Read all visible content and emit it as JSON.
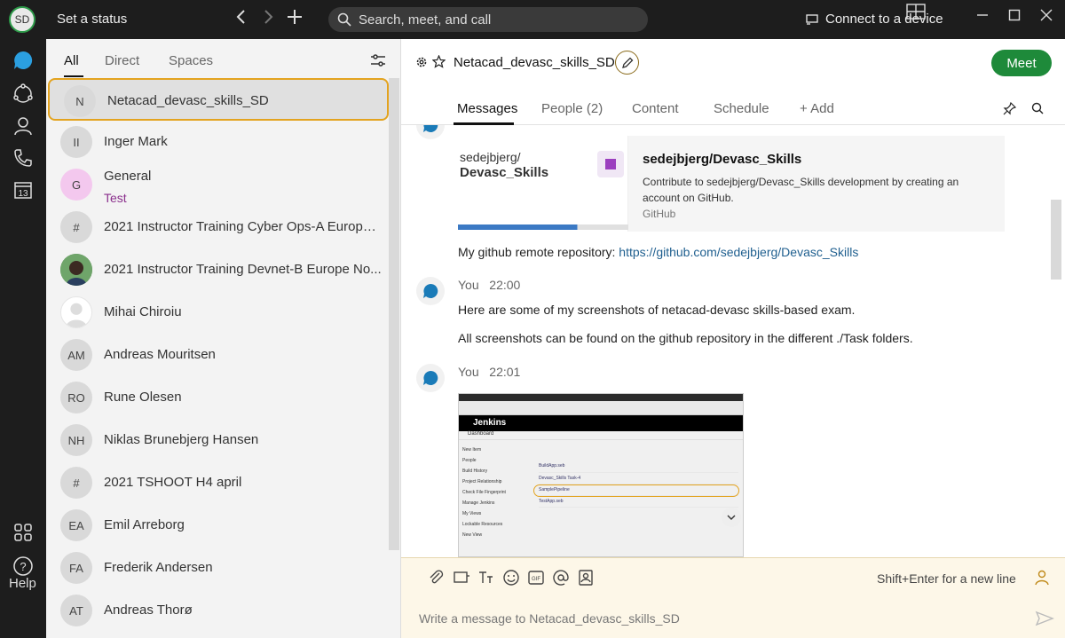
{
  "titlebar": {
    "avatar_initials": "SD",
    "set_status": "Set a status",
    "search_placeholder": "Search, meet, and call",
    "connect": "Connect to a device"
  },
  "rail": {
    "help": "Help",
    "calendar_day": "13"
  },
  "list": {
    "tabs": [
      "All",
      "Direct",
      "Spaces"
    ],
    "rows": [
      {
        "initials": "N",
        "name": "Netacad_devasc_skills_SD",
        "selected": true
      },
      {
        "initials": "II",
        "name": "Inger Mark"
      },
      {
        "initials": "G",
        "name": "General",
        "sub": "Test"
      },
      {
        "initials": "#",
        "name": "2021 Instructor Training Cyber Ops-A Europe ..."
      },
      {
        "initials": "",
        "name": "2021 Instructor Training Devnet-B Europe No..."
      },
      {
        "initials": "",
        "name": "Mihai Chiroiu"
      },
      {
        "initials": "AM",
        "name": "Andreas Mouritsen"
      },
      {
        "initials": "RO",
        "name": "Rune Olesen"
      },
      {
        "initials": "NH",
        "name": "Niklas Brunebjerg Hansen"
      },
      {
        "initials": "#",
        "name": "2021 TSHOOT H4 april"
      },
      {
        "initials": "EA",
        "name": "Emil Arreborg"
      },
      {
        "initials": "FA",
        "name": "Frederik Andersen"
      },
      {
        "initials": "AT",
        "name": "Andreas Thorø"
      }
    ]
  },
  "main": {
    "title": "Netacad_devasc_skills_SD",
    "meet": "Meet",
    "tabs": [
      "Messages",
      "People (2)",
      "Content",
      "Schedule",
      "+ Add"
    ]
  },
  "card": {
    "image_line1": "sedejbjerg/",
    "image_line2": "Devasc_Skills",
    "title": "sedejbjerg/Devasc_Skills",
    "description": "Contribute to sedejbjerg/Devasc_Skills development by creating an account on GitHub.",
    "source": "GitHub"
  },
  "messages": {
    "repo_prefix": "My github remote repository: ",
    "repo_link": "https://github.com/sedejbjerg/Devasc_Skills",
    "m1_sender": "You",
    "m1_time": "22:00",
    "m1_line1": "Here are some of my screenshots of netacad-devasc skills-based exam.",
    "m1_line2": "All screenshots can be found on the github repository in the different ./Task folders.",
    "m2_sender": "You",
    "m2_time": "22:01"
  },
  "screenshot": {
    "app_name": "Jenkins",
    "tab": "Dashboard",
    "sidebar": [
      "New Item",
      "People",
      "Build History",
      "Project Relationship",
      "Check File Fingerprint",
      "Manage Jenkins",
      "My Views",
      "Lockable Resources",
      "New View"
    ],
    "jobs": [
      "BuildApp.seb",
      "Devasc_Skills Task-4",
      "SamplePipeline",
      "TestApp.seb"
    ]
  },
  "composer": {
    "hint": "Shift+Enter for a new line",
    "placeholder": "Write a message to Netacad_devasc_skills_SD"
  }
}
